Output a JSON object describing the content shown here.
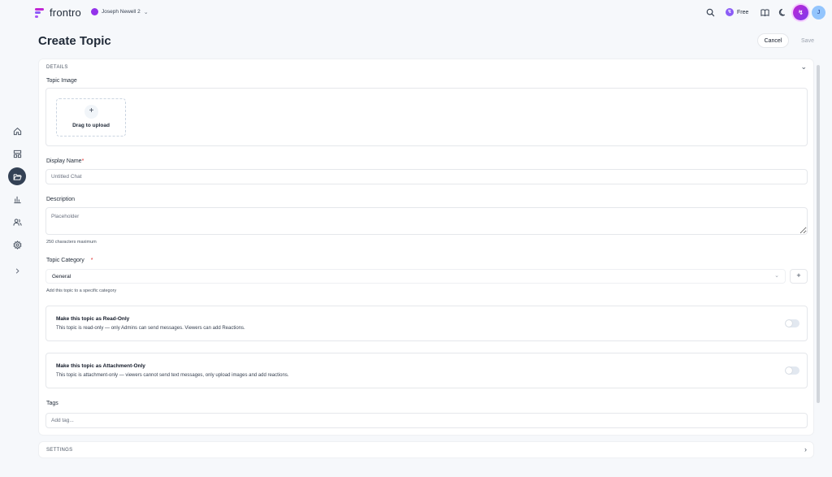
{
  "app": {
    "brand": "frontro",
    "workspace": "Joseph Newell 2"
  },
  "header": {
    "plan_label": "Free",
    "avatar_initial": "J"
  },
  "page": {
    "title": "Create Topic",
    "cancel_label": "Cancel",
    "save_label": "Save"
  },
  "details": {
    "section_label": "DETAILS",
    "topic_image_label": "Topic Image",
    "upload_text": "Drag to upload",
    "display_name_label": "Display Name",
    "display_name_placeholder": "Untitled Chat",
    "description_label": "Description",
    "description_placeholder": "Placeholder",
    "description_hint": "250 characters maximum",
    "category_label": "Topic Category",
    "category_value": "General",
    "category_hint": "Add this topic to a specific category",
    "read_only_title": "Make this topic as Read-Only",
    "read_only_desc": "This topic is read-only — only Admins can send messages. Viewers can add Reactions.",
    "read_only_enabled": false,
    "attachment_only_title": "Make this topic as Attachment-Only",
    "attachment_only_desc": "This topic is attachment-only — viewers cannot send text messages, only upload images and add reactions.",
    "attachment_only_enabled": false,
    "tags_label": "Tags",
    "tags_placeholder": "Add tag..."
  },
  "settings": {
    "section_label": "SETTINGS"
  },
  "required_marker": "*",
  "colors": {
    "accent": "#8b5cf6",
    "brand": "#c026d3",
    "nav_active": "#334155"
  }
}
